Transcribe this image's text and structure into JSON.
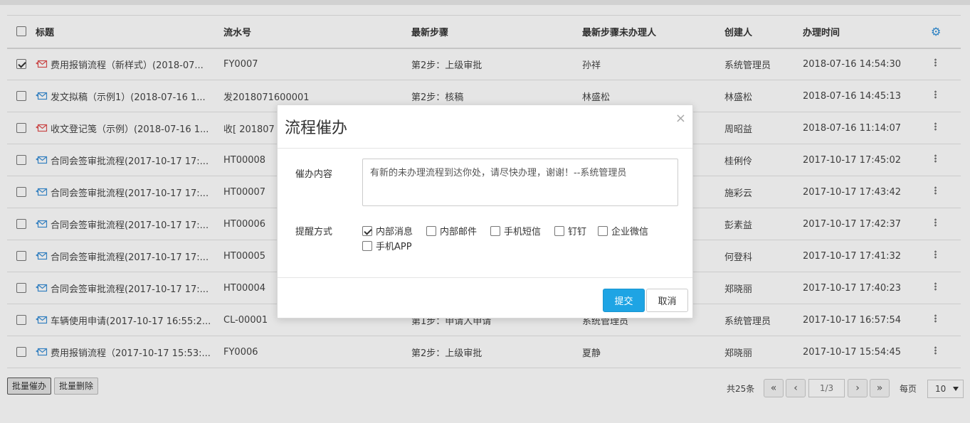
{
  "table": {
    "headers": {
      "title": "标题",
      "serial": "流水号",
      "step": "最新步骤",
      "handler": "最新步骤未办理人",
      "creator": "创建人",
      "time": "办理时间"
    },
    "rows": [
      {
        "checked": true,
        "icon": "mail-unread-icon",
        "title": "费用报销流程（新样式）(2018-07...",
        "serial": "FY0007",
        "step": "第2步：上级审批",
        "handler": "孙祥",
        "creator": "系统管理员",
        "time": "2018-07-16 14:54:30"
      },
      {
        "checked": false,
        "icon": "mail-read-icon",
        "title": "发文拟稿（示例1）(2018-07-16 1...",
        "serial": "发2018071600001",
        "step": "第2步：核稿",
        "handler": "林盛松",
        "creator": "林盛松",
        "time": "2018-07-16 14:45:13"
      },
      {
        "checked": false,
        "icon": "mail-unread-icon",
        "title": "收文登记笺（示例）(2018-07-16 1...",
        "serial": "收[ 201807",
        "step": "",
        "handler": "",
        "creator": "周昭益",
        "time": "2018-07-16 11:14:07"
      },
      {
        "checked": false,
        "icon": "mail-read-icon",
        "title": "合同会签审批流程(2017-10-17 17:...",
        "serial": "HT00008",
        "step": "",
        "handler": "",
        "creator": "桂俐伶",
        "time": "2017-10-17 17:45:02"
      },
      {
        "checked": false,
        "icon": "mail-read-icon",
        "title": "合同会签审批流程(2017-10-17 17:...",
        "serial": "HT00007",
        "step": "",
        "handler": "",
        "creator": "施彩云",
        "time": "2017-10-17 17:43:42"
      },
      {
        "checked": false,
        "icon": "mail-read-icon",
        "title": "合同会签审批流程(2017-10-17 17:...",
        "serial": "HT00006",
        "step": "",
        "handler": "",
        "creator": "彭素益",
        "time": "2017-10-17 17:42:37"
      },
      {
        "checked": false,
        "icon": "mail-read-icon",
        "title": "合同会签审批流程(2017-10-17 17:...",
        "serial": "HT00005",
        "step": "",
        "handler": "",
        "creator": "何登科",
        "time": "2017-10-17 17:41:32"
      },
      {
        "checked": false,
        "icon": "mail-read-icon",
        "title": "合同会签审批流程(2017-10-17 17:...",
        "serial": "HT00004",
        "step": "",
        "handler": "",
        "creator": "郑晓丽",
        "time": "2017-10-17 17:40:23"
      },
      {
        "checked": false,
        "icon": "mail-read-icon",
        "title": "车辆使用申请(2017-10-17 16:55:2...",
        "serial": "CL-00001",
        "step": "第1步：申请人申请",
        "handler": "系统管理员",
        "creator": "系统管理员",
        "time": "2017-10-17 16:57:54"
      },
      {
        "checked": false,
        "icon": "mail-read-icon",
        "title": "费用报销流程（2017-10-17 15:53:...",
        "serial": "FY0006",
        "step": "第2步：上级审批",
        "handler": "夏静",
        "creator": "郑晓丽",
        "time": "2017-10-17 15:54:45"
      }
    ]
  },
  "bottom": {
    "batch_remind": "批量催办",
    "batch_delete": "批量删除",
    "total": "共25条",
    "first": "«",
    "prev": "‹",
    "page": "1/3",
    "next": "›",
    "last": "»",
    "per_page_label": "每页",
    "per_page_value": "10"
  },
  "modal": {
    "title": "流程催办",
    "close": "×",
    "content_label": "催办内容",
    "content_value": "有新的未办理流程到达你处，请尽快办理，谢谢！--系统管理员",
    "method_label": "提醒方式",
    "options": [
      {
        "label": "内部消息",
        "checked": true
      },
      {
        "label": "内部邮件",
        "checked": false
      },
      {
        "label": "手机短信",
        "checked": false
      },
      {
        "label": "钉钉",
        "checked": false
      },
      {
        "label": "企业微信",
        "checked": false
      },
      {
        "label": "手机APP",
        "checked": false
      }
    ],
    "submit": "提交",
    "cancel": "取消"
  },
  "colors": {
    "primary": "#1ea4e4",
    "gear": "#2f8fd8",
    "mail_unread": "#e05050",
    "mail_read": "#3a8fd6"
  }
}
